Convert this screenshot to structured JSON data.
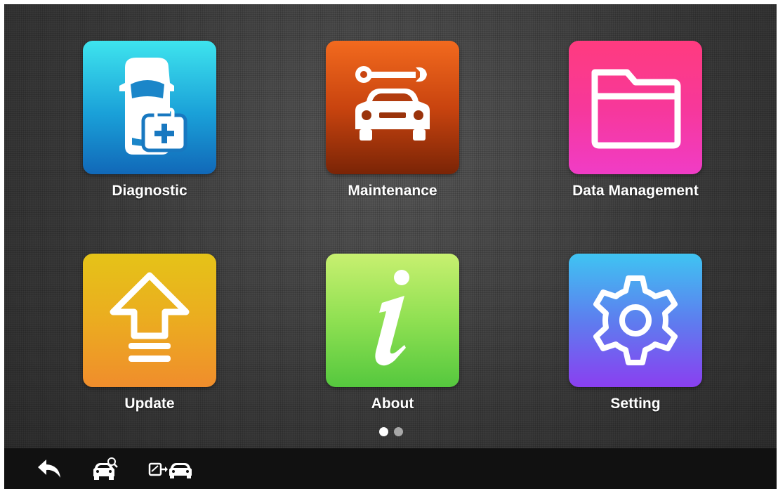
{
  "apps": [
    {
      "id": "diagnostic",
      "label": "Diagnostic",
      "icon": "car-medkit-icon"
    },
    {
      "id": "maintenance",
      "label": "Maintenance",
      "icon": "wrench-car-icon"
    },
    {
      "id": "data_management",
      "label": "Data Management",
      "icon": "folder-icon"
    },
    {
      "id": "update",
      "label": "Update",
      "icon": "upload-arrow-icon"
    },
    {
      "id": "about",
      "label": "About",
      "icon": "info-icon"
    },
    {
      "id": "setting",
      "label": "Setting",
      "icon": "gear-icon"
    }
  ],
  "pagination": {
    "current": 1,
    "total": 2
  },
  "bottom_bar": [
    {
      "id": "back",
      "icon": "back-arrow-icon"
    },
    {
      "id": "vehicle_search",
      "icon": "car-search-icon"
    },
    {
      "id": "vci_connect",
      "icon": "vci-car-connection-icon"
    }
  ]
}
